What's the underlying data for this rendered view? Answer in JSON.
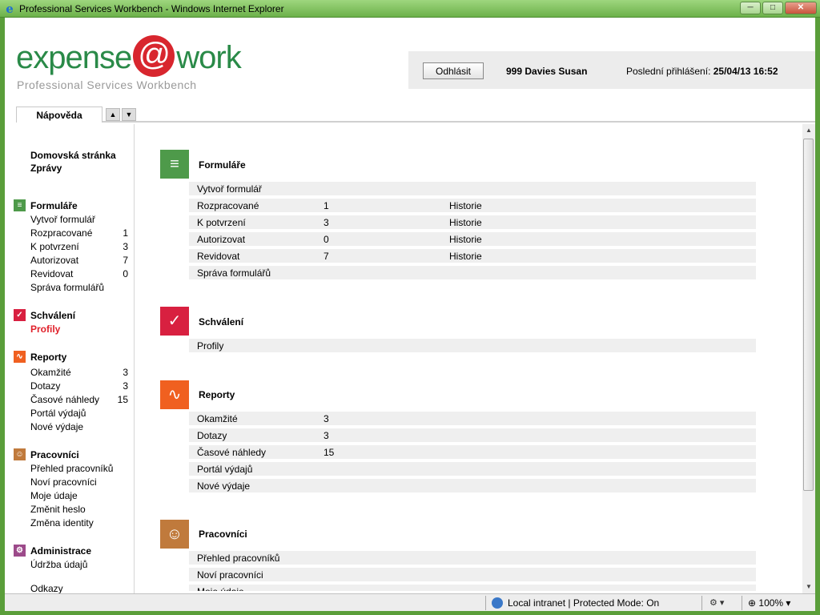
{
  "window": {
    "title": "Professional Services Workbench - Windows Internet Explorer",
    "minimize_icon": "minimize-icon",
    "maximize_icon": "maximize-icon",
    "close_icon": "close-icon"
  },
  "header": {
    "logo_left": "expense",
    "logo_at": "@",
    "logo_right": "work",
    "subtitle": "Professional Services Workbench",
    "logout_label": "Odhlásit",
    "user_name": "999 Davies Susan",
    "last_login_label": "Poslední přihlášení:",
    "last_login_value": "25/04/13 16:52"
  },
  "tab": {
    "label": "Nápověda"
  },
  "sidebar": {
    "home": "Domovská stránka",
    "messages": "Zprávy",
    "forms_head": "Formuláře",
    "forms_items": [
      {
        "label": "Vytvoř formulář",
        "count": ""
      },
      {
        "label": "Rozpracované",
        "count": "1"
      },
      {
        "label": "K potvrzení",
        "count": "3"
      },
      {
        "label": "Autorizovat",
        "count": "7"
      },
      {
        "label": "Revidovat",
        "count": "0"
      },
      {
        "label": "Správa formulářů",
        "count": ""
      }
    ],
    "approval_head": "Schválení",
    "approval_items": [
      {
        "label": "Profily",
        "count": ""
      }
    ],
    "reports_head": "Reporty",
    "reports_items": [
      {
        "label": "Okamžité",
        "count": "3"
      },
      {
        "label": "Dotazy",
        "count": "3"
      },
      {
        "label": "Časové náhledy",
        "count": "15"
      },
      {
        "label": "Portál výdajů",
        "count": ""
      },
      {
        "label": "Nové výdaje",
        "count": ""
      }
    ],
    "workers_head": "Pracovníci",
    "workers_items": [
      {
        "label": "Přehled pracovníků"
      },
      {
        "label": "Noví pracovníci"
      },
      {
        "label": "Moje údaje"
      },
      {
        "label": "Změnit heslo"
      },
      {
        "label": "Změna identity"
      }
    ],
    "admin_head": "Administrace",
    "admin_items": [
      {
        "label": "Údržba údajů"
      }
    ],
    "links": "Odkazy"
  },
  "main": {
    "forms": {
      "title": "Formuláře",
      "rows": [
        {
          "label": "Vytvoř formulář",
          "count": "",
          "history": ""
        },
        {
          "label": "Rozpracované",
          "count": "1",
          "history": "Historie"
        },
        {
          "label": "K potvrzení",
          "count": "3",
          "history": "Historie"
        },
        {
          "label": "Autorizovat",
          "count": "0",
          "history": "Historie"
        },
        {
          "label": "Revidovat",
          "count": "7",
          "history": "Historie"
        },
        {
          "label": "Správa formulářů",
          "count": "",
          "history": ""
        }
      ]
    },
    "approval": {
      "title": "Schválení",
      "rows": [
        {
          "label": "Profily"
        }
      ]
    },
    "reports": {
      "title": "Reporty",
      "rows": [
        {
          "label": "Okamžité",
          "count": "3"
        },
        {
          "label": "Dotazy",
          "count": "3"
        },
        {
          "label": "Časové náhledy",
          "count": "15"
        },
        {
          "label": "Portál výdajů",
          "count": ""
        },
        {
          "label": "Nové výdaje",
          "count": ""
        }
      ]
    },
    "workers": {
      "title": "Pracovníci",
      "rows": [
        {
          "label": "Přehled pracovníků"
        },
        {
          "label": "Noví pracovníci"
        },
        {
          "label": "Moje údaje"
        }
      ]
    }
  },
  "statusbar": {
    "zone": "Local intranet | Protected Mode: On",
    "zoom": "100%"
  },
  "colors": {
    "forms": "#4e9a4a",
    "approval": "#d82040",
    "reports": "#f06020",
    "workers": "#c07a3c",
    "admin": "#9c4a8a",
    "logo_green": "#2a8a48",
    "logo_red": "#d8262e",
    "active_link": "#e0202a"
  }
}
